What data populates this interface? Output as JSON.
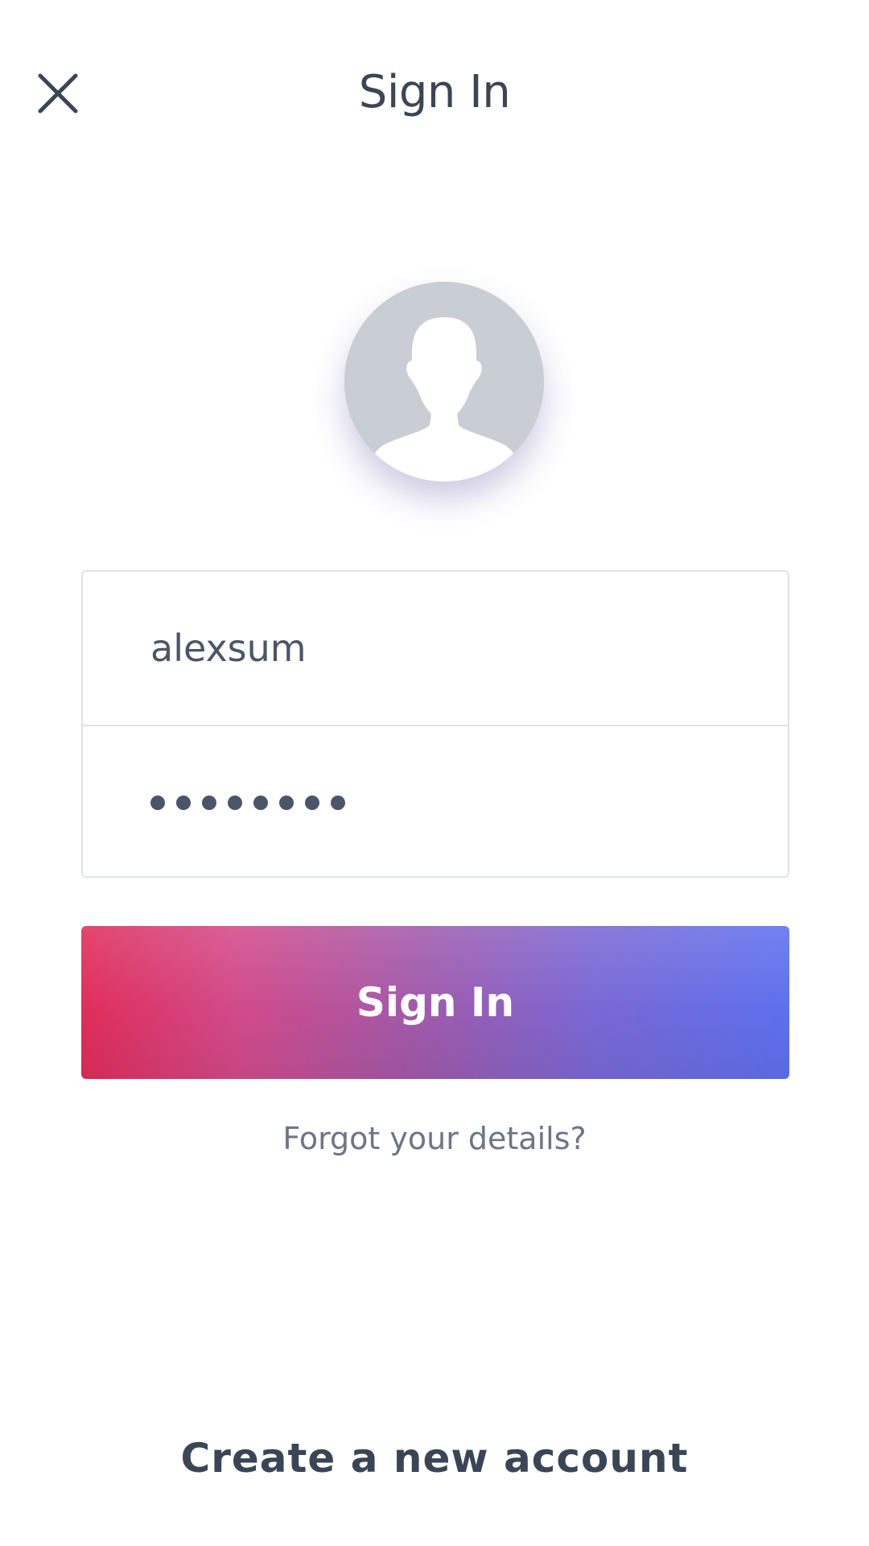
{
  "header": {
    "title": "Sign In",
    "close_icon": "close-icon"
  },
  "avatar": {
    "icon": "user-silhouette-icon"
  },
  "form": {
    "username_value": "alexsum",
    "password_masked": "••••••••",
    "password_length": 8
  },
  "actions": {
    "signin_label": "Sign In",
    "forgot_label": "Forgot your details?",
    "create_label": "Create a new account"
  },
  "colors": {
    "text": "#3a4656",
    "gradient_start": "#e02d59",
    "gradient_end": "#5d70ee",
    "avatar_bg": "#c9ced5"
  }
}
